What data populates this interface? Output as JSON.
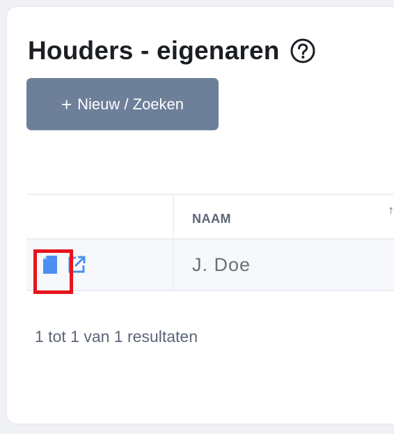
{
  "page": {
    "title": "Houders - eigenaren",
    "new_button_label": "Nieuw / Zoeken"
  },
  "table": {
    "columns": [
      "NAAM"
    ],
    "rows": [
      {
        "name": "J. Doe"
      }
    ]
  },
  "footer": {
    "results_text": "1 tot 1 van 1 resultaten"
  },
  "colors": {
    "button": "#6e7f99",
    "icon_blue": "#4d8ff0",
    "highlight": "#e8141b"
  },
  "icons": {
    "help": "help-circle-icon",
    "document": "document-icon",
    "external_link": "external-link-icon",
    "sort": "sort-arrow-icon"
  }
}
